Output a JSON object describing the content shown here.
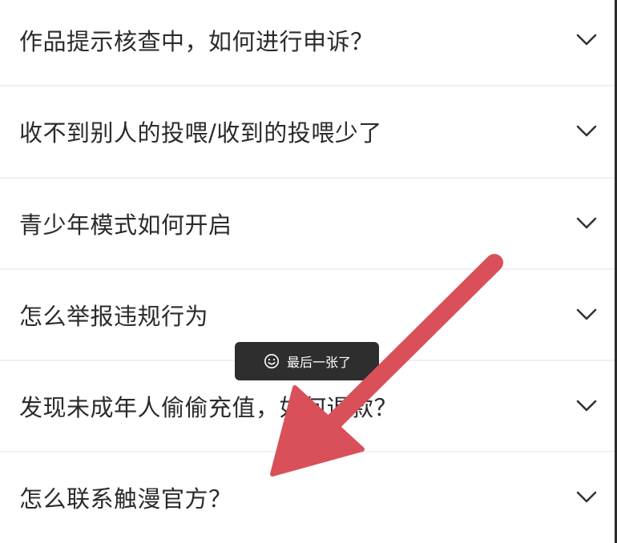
{
  "faq": {
    "items": [
      {
        "question": "作品提示核查中，如何进行申诉？"
      },
      {
        "question": "收不到别人的投喂/收到的投喂少了"
      },
      {
        "question": "青少年模式如何开启"
      },
      {
        "question": "怎么举报违规行为"
      },
      {
        "question": "发现未成年人偷偷充值，如何退款？"
      },
      {
        "question": "怎么联系触漫官方？"
      }
    ],
    "chevron_icon": "chevron-down-icon"
  },
  "toast": {
    "icon": "smile-icon",
    "message": "最后一张了"
  },
  "annotation": {
    "icon": "red-arrow-pointer",
    "color": "#d9505a"
  }
}
